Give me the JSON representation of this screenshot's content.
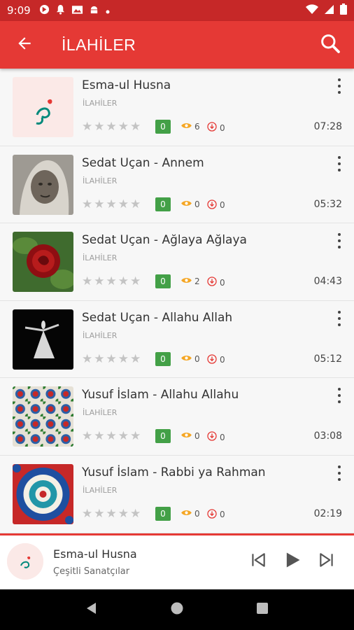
{
  "status_bar": {
    "time": "9:09",
    "icons": [
      "maps-icon",
      "notification-bell-icon",
      "image-icon",
      "android-icon",
      "dot-icon"
    ],
    "right_icons": [
      "wifi-icon",
      "signal-icon",
      "battery-icon"
    ]
  },
  "app_bar": {
    "title": "İLAHİLER",
    "back_icon": "arrow-left-icon",
    "search_icon": "search-icon",
    "color": "#e53935"
  },
  "songs": [
    {
      "title": "Esma-ul Husna",
      "category": "İLAHİLER",
      "rating": "0",
      "views": "6",
      "downloads": "0",
      "duration": "07:28",
      "thumb": "calligraphy"
    },
    {
      "title": "Sedat Uçan - Annem",
      "category": "İLAHİLER",
      "rating": "0",
      "views": "0",
      "downloads": "0",
      "duration": "05:32",
      "thumb": "portrait"
    },
    {
      "title": "Sedat Uçan - Ağlaya Ağlaya",
      "category": "İLAHİLER",
      "rating": "0",
      "views": "2",
      "downloads": "0",
      "duration": "04:43",
      "thumb": "rose"
    },
    {
      "title": "Sedat Uçan - Allahu Allah",
      "category": "İLAHİLER",
      "rating": "0",
      "views": "0",
      "downloads": "0",
      "duration": "05:12",
      "thumb": "dervish"
    },
    {
      "title": "Yusuf İslam - Allahu Allahu",
      "category": "İLAHİLER",
      "rating": "0",
      "views": "0",
      "downloads": "0",
      "duration": "03:08",
      "thumb": "tiles"
    },
    {
      "title": "Yusuf İslam - Rabbi ya Rahman",
      "category": "İLAHİLER",
      "rating": "0",
      "views": "0",
      "downloads": "0",
      "duration": "02:19",
      "thumb": "mandala"
    }
  ],
  "player": {
    "title": "Esma-ul Husna",
    "artist": "Çeşitli Sanatçılar",
    "controls": [
      "skip-previous-icon",
      "play-icon",
      "skip-next-icon"
    ]
  },
  "nav_bar": {
    "buttons": [
      "back-triangle-icon",
      "home-circle-icon",
      "recents-square-icon"
    ]
  }
}
